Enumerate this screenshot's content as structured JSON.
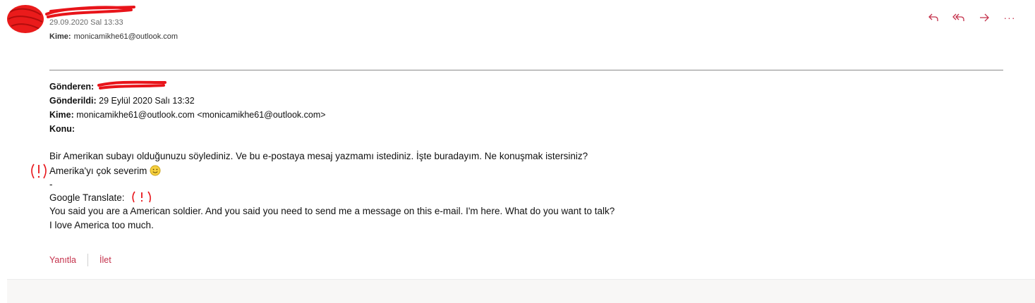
{
  "message_meta": {
    "date": "29.09.2020 Sal 13:33",
    "to_label": "Kime:",
    "to_value": "monicamikhe61@outlook.com"
  },
  "toolbar": {
    "icons": [
      "reply-icon",
      "reply-all-icon",
      "forward-icon",
      "more-icon"
    ],
    "more_glyph": "···"
  },
  "forwarded_header": {
    "from_label": "Gönderen:",
    "sent_label": "Gönderildi:",
    "sent_value": "29 Eylül 2020 Salı 13:32",
    "to_label": "Kime:",
    "to_value": "monicamikhe61@outlook.com <monicamikhe61@outlook.com>",
    "subject_label": "Konu:"
  },
  "body": {
    "line1": "Bir Amerikan subayı olduğunuzu söylediniz. Ve bu e-postaya mesaj yazmamı istediniz. İşte buradayım. Ne konuşmak istersiniz?",
    "line2": "Amerika'yı çok severim",
    "line3": "-",
    "line4": "Google Translate:",
    "line5": "You said you are a American soldier. And you said you need to send me a message on this e-mail. I'm here. What do you want to talk?",
    "line6": "I love America too much."
  },
  "footer": {
    "reply_label": "Yanıtla",
    "forward_label": "İlet"
  },
  "colors": {
    "accent": "#c4314b",
    "redaction": "#e8141a",
    "divider": "#8a8a8a"
  }
}
